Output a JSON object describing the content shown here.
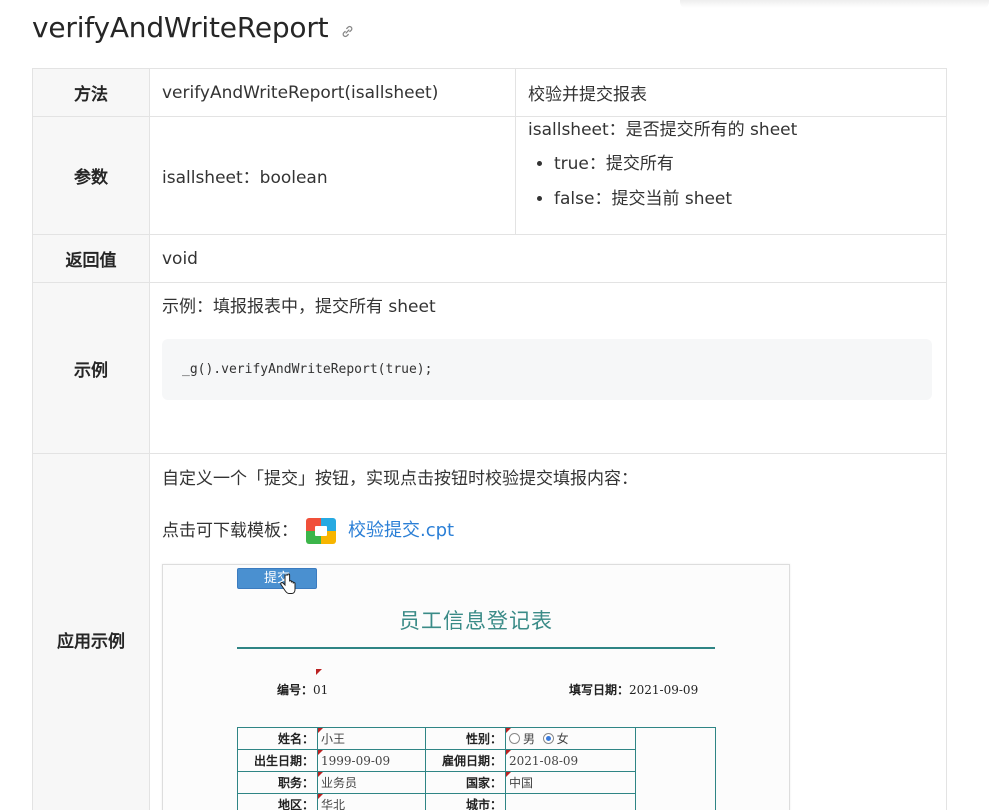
{
  "title": "verifyAndWriteReport",
  "table": {
    "method": {
      "label": "方法",
      "signature": "verifyAndWriteReport(isallsheet)",
      "desc": "校验并提交报表"
    },
    "params": {
      "label": "参数",
      "type": "isallsheet：boolean",
      "desc": "isallsheet：是否提交所有的 sheet",
      "options": [
        "true：提交所有",
        "false：提交当前 sheet"
      ]
    },
    "returns": {
      "label": "返回值",
      "value": "void"
    },
    "example": {
      "label": "示例",
      "text": "示例：填报报表中，提交所有 sheet",
      "code": "_g().verifyAndWriteReport(true);"
    },
    "app_example": {
      "label": "应用示例",
      "intro": "自定义一个「提交」按钮，实现点击按钮时校验提交填报内容：",
      "download_prefix": "点击可下载模板：",
      "download_link": "校验提交.cpt"
    }
  },
  "preview": {
    "submit_button": "提交",
    "form_title": "员工信息登记表",
    "id_label": "编号：",
    "id_value": "01",
    "date_label": "填写日期：",
    "date_value": "2021-09-09",
    "rows": [
      {
        "l1": "姓名：",
        "v1": "小王",
        "l2": "性别：",
        "v2": ""
      },
      {
        "l1": "出生日期：",
        "v1": "1999-09-09",
        "l2": "雇佣日期：",
        "v2": "2021-08-09"
      },
      {
        "l1": "职务：",
        "v1": "业务员",
        "l2": "国家：",
        "v2": "中国"
      },
      {
        "l1": "地区：",
        "v1": "华北",
        "l2": "城市：",
        "v2": ""
      }
    ],
    "gender_options": [
      "男",
      "女"
    ],
    "gender_selected": "女"
  },
  "colors": {
    "link": "#2b7fd6",
    "form_accent": "#2f8585",
    "submit_bg": "#4a90d0",
    "header_bg": "#f7f7f7"
  }
}
